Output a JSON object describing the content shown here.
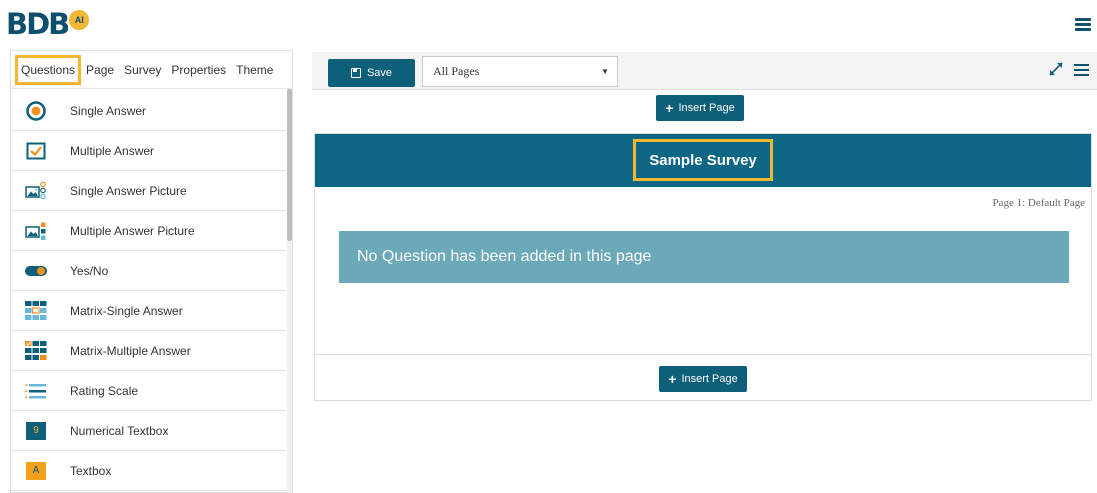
{
  "header": {
    "logo_text": "BDB",
    "logo_badge": "AI"
  },
  "left_panel": {
    "tabs": [
      {
        "label": "Questions",
        "active": true
      },
      {
        "label": "Page",
        "active": false
      },
      {
        "label": "Survey",
        "active": false
      },
      {
        "label": "Properties",
        "active": false
      },
      {
        "label": "Theme",
        "active": false
      }
    ],
    "question_types": [
      {
        "label": "Single Answer",
        "icon": "radio-icon"
      },
      {
        "label": "Multiple Answer",
        "icon": "checkbox-icon"
      },
      {
        "label": "Single Answer Picture",
        "icon": "picture-radio-icon"
      },
      {
        "label": "Multiple Answer Picture",
        "icon": "picture-checkbox-icon"
      },
      {
        "label": "Yes/No",
        "icon": "toggle-icon"
      },
      {
        "label": "Matrix-Single Answer",
        "icon": "matrix-single-icon"
      },
      {
        "label": "Matrix-Multiple Answer",
        "icon": "matrix-multiple-icon"
      },
      {
        "label": "Rating Scale",
        "icon": "rating-scale-icon"
      },
      {
        "label": "Numerical Textbox",
        "icon": "numerical-textbox-icon"
      },
      {
        "label": "Textbox",
        "icon": "textbox-icon"
      }
    ],
    "numeric_icon_glyph": "9",
    "text_icon_glyph": "A"
  },
  "toolbar": {
    "save_label": "Save",
    "page_select_value": "All Pages"
  },
  "canvas": {
    "insert_page_label": "Insert Page",
    "survey_title": "Sample Survey",
    "page_label": "Page 1:  Default Page",
    "empty_message": "No Question has been added in this page"
  },
  "colors": {
    "primary": "#0d5f7a",
    "header_band": "#0d6683",
    "highlight": "#f2b632",
    "empty_box": "#6ba8b8"
  }
}
